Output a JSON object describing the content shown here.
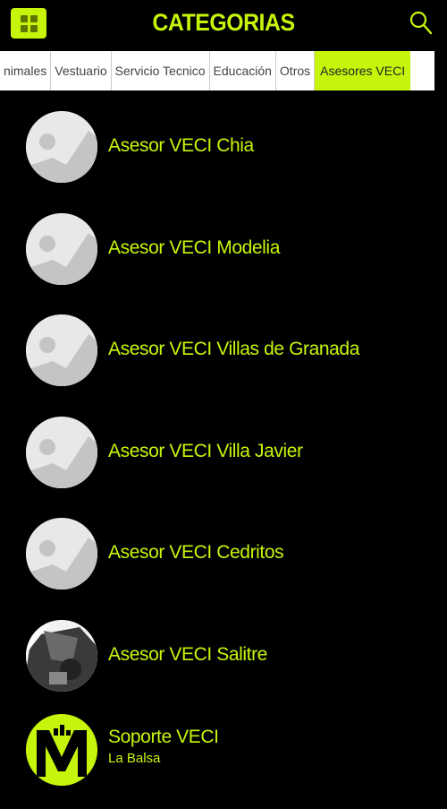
{
  "header": {
    "title": "CATEGORIAS"
  },
  "tabs": [
    {
      "label": "nimales",
      "active": false
    },
    {
      "label": "Vestuario",
      "active": false
    },
    {
      "label": "Servicio Tecnico",
      "active": false
    },
    {
      "label": "Educación",
      "active": false
    },
    {
      "label": "Otros",
      "active": false
    },
    {
      "label": "Asesores VECI",
      "active": true
    }
  ],
  "advisors": [
    {
      "name": "Asesor VECI Chia",
      "avatar": "placeholder"
    },
    {
      "name": "Asesor VECI Modelia",
      "avatar": "placeholder"
    },
    {
      "name": "Asesor VECI Villas de Granada",
      "avatar": "placeholder"
    },
    {
      "name": "Asesor VECI Villa Javier",
      "avatar": "placeholder"
    },
    {
      "name": "Asesor VECI Cedritos",
      "avatar": "placeholder"
    },
    {
      "name": "Asesor VECI Salitre",
      "avatar": "photo"
    }
  ],
  "support": {
    "title": "Soporte VECI",
    "subtitle": "La Balsa",
    "logo_letter": "M"
  },
  "colors": {
    "accent": "#c6f50b",
    "background": "#000000",
    "tab_bg": "#ffffff"
  }
}
